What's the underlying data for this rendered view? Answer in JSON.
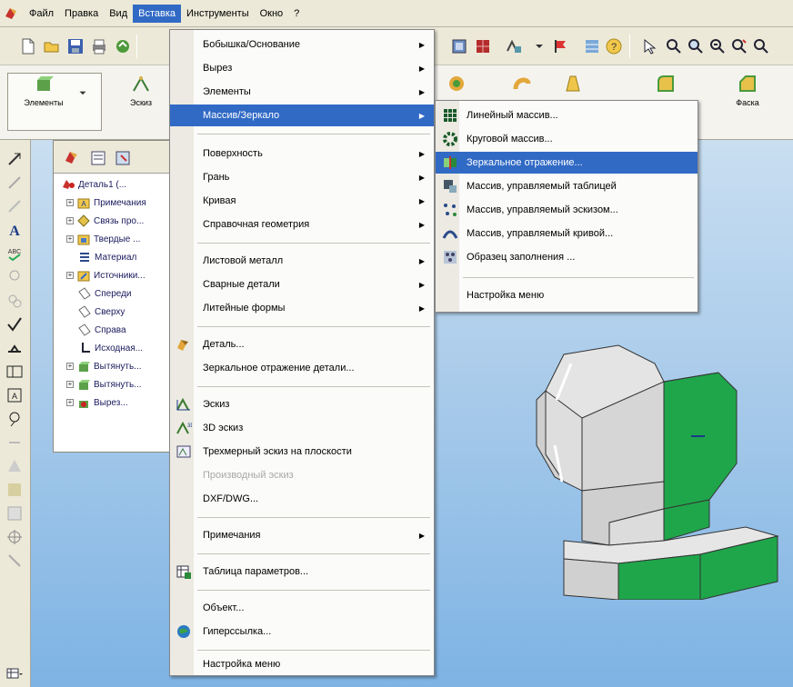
{
  "menubar": {
    "items": [
      "Файл",
      "Правка",
      "Вид",
      "Вставка",
      "Инструменты",
      "Окно",
      "?"
    ]
  },
  "cmdmanager": {
    "left_button": "Элементы",
    "second_button": "Эскиз",
    "right_button_partial": "...",
    "fillet_label": "Фаска"
  },
  "tree": {
    "items": [
      {
        "label": "Деталь1 (...",
        "expand": false
      },
      {
        "label": "Примечания",
        "expand": true
      },
      {
        "label": "Связь про...",
        "expand": true
      },
      {
        "label": "Твердые ...",
        "expand": true
      },
      {
        "label": "Материал",
        "expand": false
      },
      {
        "label": "Источники...",
        "expand": true
      },
      {
        "label": "Спереди",
        "expand": false
      },
      {
        "label": "Сверху",
        "expand": false
      },
      {
        "label": "Справа",
        "expand": false
      },
      {
        "label": "Исходная...",
        "expand": false
      },
      {
        "label": "Вытянуть...",
        "expand": true
      },
      {
        "label": "Вытянуть...",
        "expand": true
      },
      {
        "label": "Вырез...",
        "expand": true
      }
    ]
  },
  "insert_menu": {
    "items": [
      {
        "label": "Бобышка/Основание",
        "arrow": true
      },
      {
        "label": "Вырез",
        "arrow": true
      },
      {
        "label": "Элементы",
        "arrow": true
      },
      {
        "label": "Массив/Зеркало",
        "arrow": true,
        "selected": true
      },
      {
        "label": "Поверхность",
        "arrow": true
      },
      {
        "label": "Грань",
        "arrow": true
      },
      {
        "label": "Кривая",
        "arrow": true
      },
      {
        "label": "Справочная геометрия",
        "arrow": true
      },
      {
        "label": "Листовой металл",
        "arrow": true
      },
      {
        "label": "Сварные детали",
        "arrow": true
      },
      {
        "label": "Литейные формы",
        "arrow": true
      },
      {
        "label": "Деталь...",
        "arrow": false
      },
      {
        "label": "Зеркальное отражение детали...",
        "arrow": false
      },
      {
        "label": "Эскиз",
        "arrow": false
      },
      {
        "label": "3D эскиз",
        "arrow": false
      },
      {
        "label": "Трехмерный эскиз на плоскости",
        "arrow": false
      },
      {
        "label": "Производный эскиз",
        "arrow": false,
        "disabled": true
      },
      {
        "label": "DXF/DWG...",
        "arrow": false
      },
      {
        "label": "Примечания",
        "arrow": true
      },
      {
        "label": "Таблица параметров...",
        "arrow": false
      },
      {
        "label": "Объект...",
        "arrow": false
      },
      {
        "label": "Гиперссылка...",
        "arrow": false
      },
      {
        "label": "Настройка меню",
        "arrow": false
      }
    ]
  },
  "pattern_submenu": {
    "items": [
      {
        "label": "Линейный массив..."
      },
      {
        "label": "Круговой массив..."
      },
      {
        "label": "Зеркальное отражение...",
        "selected": true
      },
      {
        "label": "Массив, управляемый таблицей"
      },
      {
        "label": "Массив, управляемый эскизом..."
      },
      {
        "label": "Массив, управляемый кривой..."
      },
      {
        "label": "Образец заполнения ..."
      },
      {
        "label": "Настройка меню"
      }
    ]
  },
  "colors": {
    "menu_highlight": "#316ac5",
    "model_green": "#1fa64b",
    "model_gray": "#d9d9d9"
  }
}
